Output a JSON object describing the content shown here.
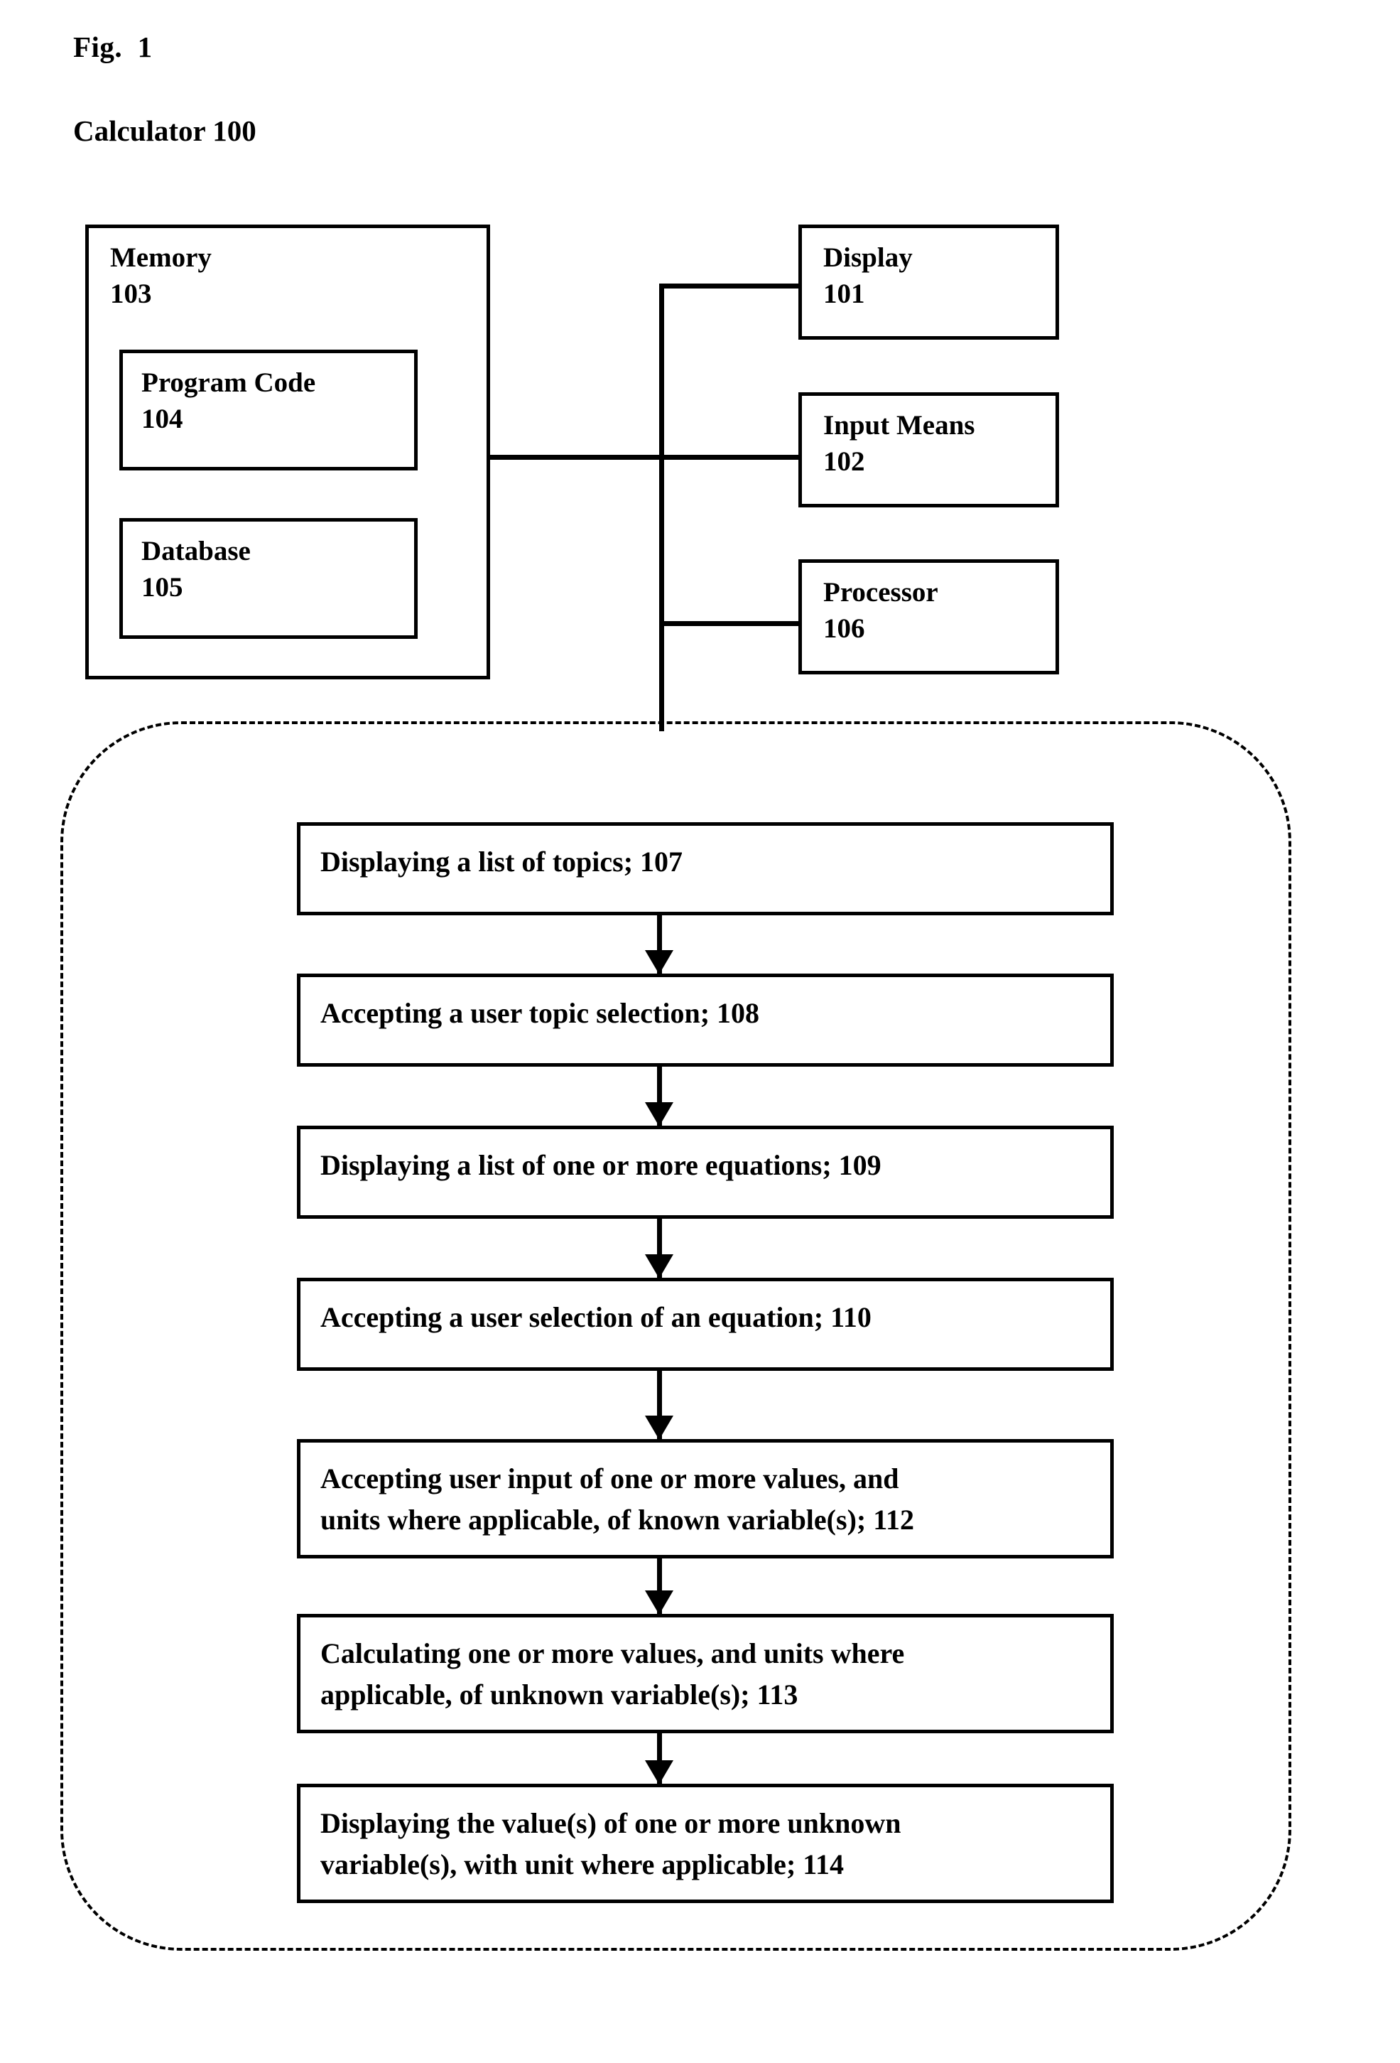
{
  "figure": {
    "fig_label": "Fig.  1",
    "title": "Calculator 100"
  },
  "hardware": {
    "memory": {
      "name": "Memory",
      "ref": "103",
      "children": [
        {
          "name": "Program Code",
          "ref": "104"
        },
        {
          "name": "Database",
          "ref": "105"
        }
      ]
    },
    "peripherals": [
      {
        "name": "Display",
        "ref": "101"
      },
      {
        "name": "Input Means",
        "ref": "102"
      },
      {
        "name": "Processor",
        "ref": "106"
      }
    ]
  },
  "flow": {
    "steps": [
      {
        "ref": "107",
        "lines": [
          "Displaying a list of topics; 107"
        ]
      },
      {
        "ref": "108",
        "lines": [
          "Accepting a user topic selection; 108"
        ]
      },
      {
        "ref": "109",
        "lines": [
          "Displaying a list of one or more equations; 109"
        ]
      },
      {
        "ref": "110",
        "lines": [
          "Accepting a user selection of an equation; 110"
        ]
      },
      {
        "ref": "112",
        "lines": [
          "Accepting user input of one or more values, and",
          "units where applicable, of known variable(s); 112"
        ]
      },
      {
        "ref": "113",
        "lines": [
          "Calculating one or more values, and units where",
          "applicable, of unknown variable(s); 113"
        ]
      },
      {
        "ref": "114",
        "lines": [
          "Displaying the value(s) of one or more unknown",
          "variable(s), with unit where applicable; 114"
        ]
      }
    ]
  },
  "colors": {
    "ink": "#000000",
    "paper": "#ffffff"
  }
}
